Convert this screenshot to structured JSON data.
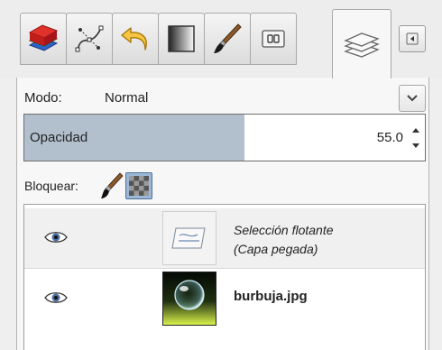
{
  "tabs": [
    {
      "name": "layers-stack-icon",
      "active": false
    },
    {
      "name": "paths-icon",
      "active": false
    },
    {
      "name": "undo-history-icon",
      "active": false
    },
    {
      "name": "gradient-icon",
      "active": false
    },
    {
      "name": "brush-icon",
      "active": false
    },
    {
      "name": "channels-icon",
      "active": false
    },
    {
      "name": "layers-icon",
      "active": true
    }
  ],
  "mode": {
    "label": "Modo:",
    "value": "Normal"
  },
  "opacity": {
    "label": "Opacidad",
    "value": "55.0",
    "fraction": 0.55
  },
  "lock": {
    "label": "Bloquear:"
  },
  "layers": [
    {
      "name_line1": "Selección flotante",
      "name_line2": "(Capa pegada)",
      "visible": true
    },
    {
      "name": "burbuja.jpg",
      "visible": true
    }
  ],
  "colors": {
    "selection_fill": "#b2c0cd",
    "lock_active": "#9db7d6"
  }
}
